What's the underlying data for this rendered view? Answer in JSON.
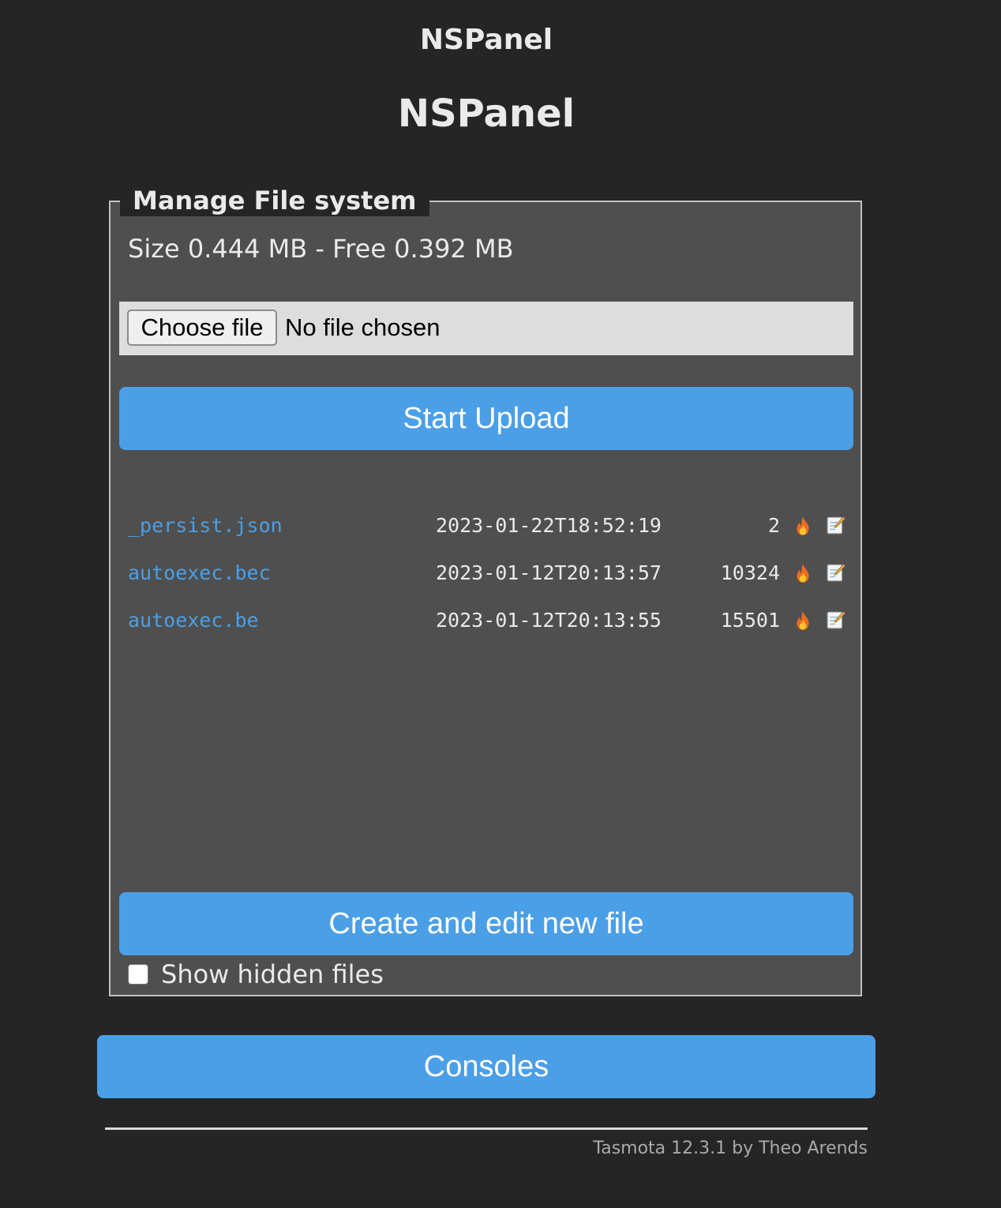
{
  "header": {
    "device_name": "NSPanel",
    "title": "NSPanel"
  },
  "filesystem": {
    "legend": "Manage File system",
    "size_info": "Size 0.444 MB - Free 0.392 MB",
    "file_input": {
      "button_label": "Choose file",
      "status": "No file chosen"
    },
    "upload_label": "Start Upload",
    "files": [
      {
        "name": "_persist.json",
        "date": "2023-01-22T18:52:19",
        "size": "2",
        "delete_icon": "fire-icon",
        "edit_icon": "edit-icon"
      },
      {
        "name": "autoexec.bec",
        "date": "2023-01-12T20:13:57",
        "size": "10324",
        "delete_icon": "fire-icon",
        "edit_icon": "edit-icon"
      },
      {
        "name": "autoexec.be",
        "date": "2023-01-12T20:13:55",
        "size": "15501",
        "delete_icon": "fire-icon",
        "edit_icon": "edit-icon"
      }
    ],
    "create_label": "Create and edit new file",
    "show_hidden_label": "Show hidden files",
    "show_hidden_checked": false
  },
  "nav": {
    "consoles_label": "Consoles"
  },
  "footer": {
    "text": "Tasmota 12.3.1 by Theo Arends"
  },
  "colors": {
    "background": "#252525",
    "panel": "#4f4f4f",
    "accent": "#4b9fe6",
    "text": "#eaeaea"
  }
}
